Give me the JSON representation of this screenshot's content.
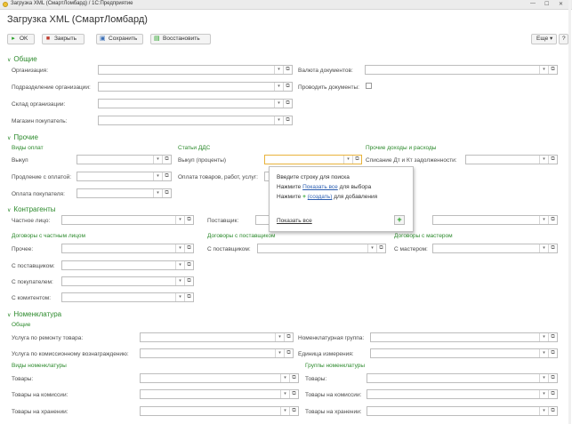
{
  "window": {
    "title": "Загрузка XML (СмартЛомбард) / 1С:Предприятие",
    "btn_min": "—",
    "btn_max": "☐",
    "btn_close": "✕"
  },
  "form": {
    "title": "Загрузка XML (СмартЛомбард)"
  },
  "toolbar": {
    "ok": "OK",
    "close": "Закрыть",
    "save": "Сохранить",
    "restore": "Восстановить",
    "more": "Еще",
    "help": "?"
  },
  "general": {
    "title": "Общие",
    "organization": "Организация:",
    "division": "Подразделение организации:",
    "warehouse": "Склад организации:",
    "shop": "Магазин покупатель:",
    "currency": "Валюта документов:",
    "post_docs": "Проводить документы:"
  },
  "other": {
    "title": "Прочие",
    "payment_types": "Виды оплат",
    "buyout": "Выкуп",
    "extension": "Продление с оплатой:",
    "purchase_payment": "Оплата покупателя:",
    "dds_items": "Статьи ДДС",
    "buyout_interest": "Выкуп (проценты)",
    "goods_payment": "Оплата товаров, работ, услуг:",
    "income_expense": "Прочие доходы и расходы",
    "writeoff": "Списание Дт и Кт задолженности:"
  },
  "popup": {
    "line1": "Введите строку для поиска",
    "press1": "Нажмите",
    "show_all_link": "Показать все",
    "for_select": "для выбора",
    "press2": "Нажмите",
    "create_link": "(создать)",
    "for_add": "для добавления",
    "show_all_bottom": "Показать все",
    "plus": "+"
  },
  "contractors": {
    "title": "Контрагенты",
    "private_person": "Частное лицо:",
    "supplier": "Поставщик:",
    "contracts_private": "Договоры с частным лицом",
    "other": "Прочее:",
    "with_supplier": "С поставщиком:",
    "with_buyer": "С покупателем:",
    "with_commissioner": "С комитентом:",
    "contracts_supplier": "Договоры с поставщиком",
    "with_supplier2": "С поставщиком:",
    "contracts_master": "Договоры с мастером",
    "with_master": "С мастером:"
  },
  "nomenclature": {
    "title": "Номенклатура",
    "general": "Общие",
    "repair_service": "Услуга по ремонту товара:",
    "commission_service": "Услуга по комиссионному вознаграждению:",
    "nom_group": "Номенклатурная группа:",
    "unit": "Единица измерения:",
    "nom_types": "Виды номенклатуры",
    "goods": "Товары:",
    "goods_commission": "Товары на комиссии:",
    "goods_storage": "Товары на хранении:",
    "nom_groups": "Группы номенклатуры",
    "goods2": "Товары:",
    "goods_commission2": "Товары на комиссии:",
    "goods_storage2": "Товары на хранении:"
  }
}
